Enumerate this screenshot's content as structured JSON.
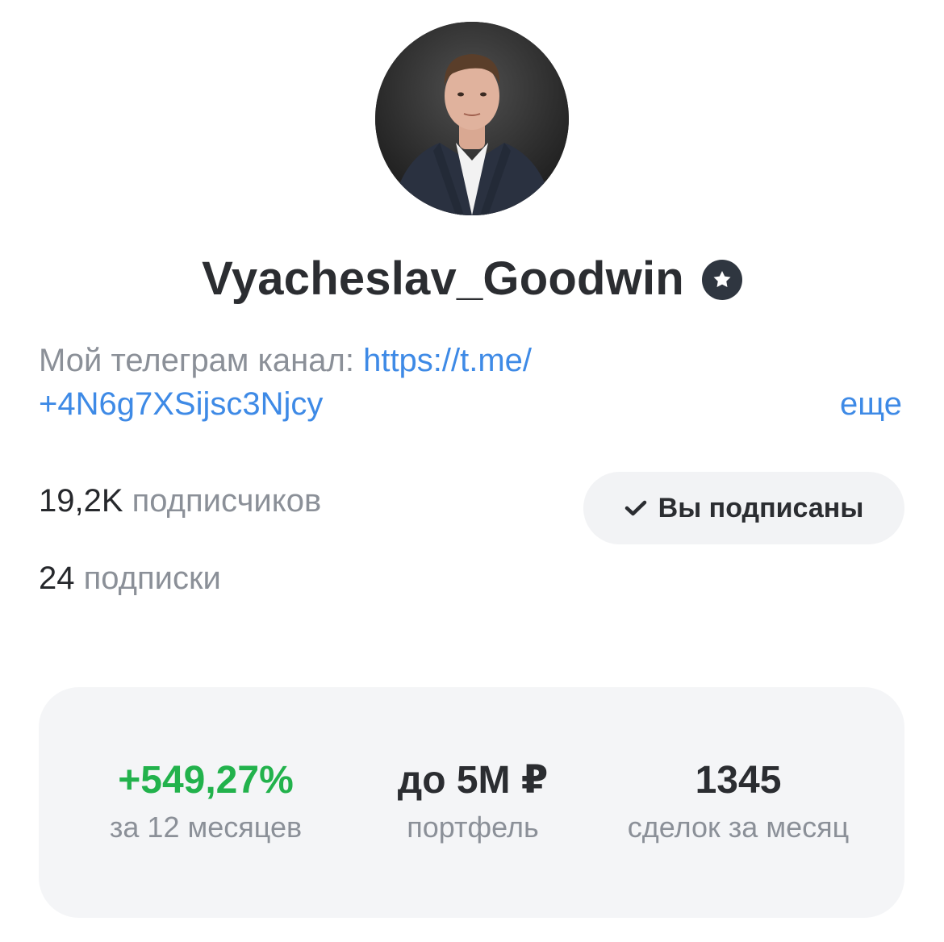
{
  "profile": {
    "name": "Vyacheslav_Goodwin",
    "badge_icon": "verified-star-icon"
  },
  "bio": {
    "prefix": "Мой телеграм канал: ",
    "link_part1": "https://t.me/",
    "link_part2": "+4N6g7XSijsc3Njcy",
    "more": "еще"
  },
  "stats": {
    "followers_count": "19,2K",
    "followers_label": " подписчиков",
    "following_count": "24",
    "following_label": " подписки"
  },
  "subscribe_button": {
    "label": "Вы подписаны",
    "icon": "checkmark-icon"
  },
  "metrics": [
    {
      "value": "+549,27%",
      "label": "за 12 месяцев",
      "color": "#22b24c"
    },
    {
      "value": "до 5M ₽",
      "label": "портфель"
    },
    {
      "value": "1345",
      "label": "сделок за месяц"
    }
  ],
  "colors": {
    "link": "#3e8ae6",
    "text": "#2b2d31",
    "muted": "#8b9098",
    "positive": "#22b24c"
  }
}
